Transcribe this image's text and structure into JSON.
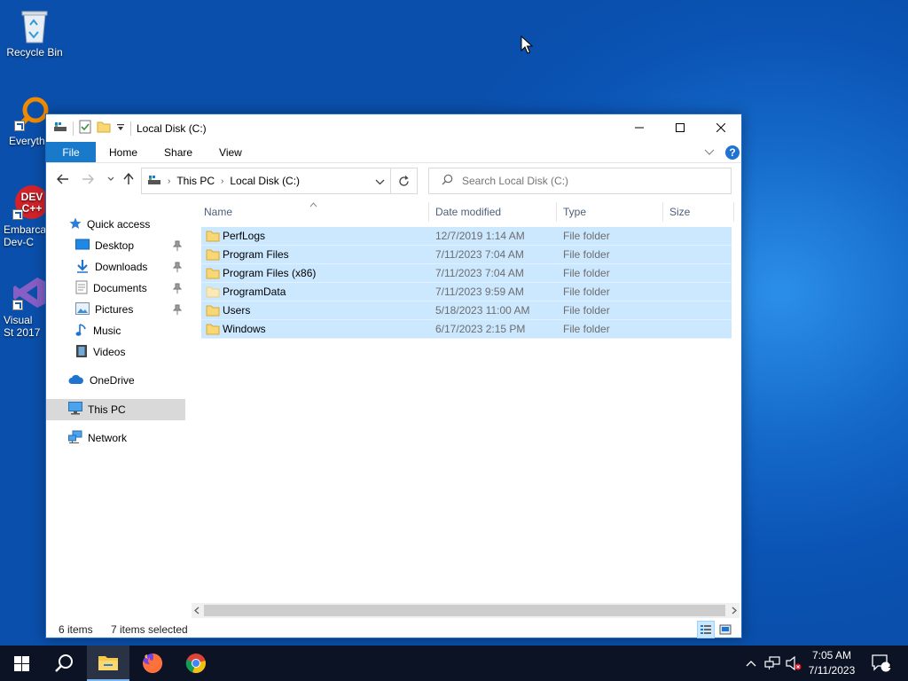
{
  "desktop": {
    "icons": [
      {
        "label": "Recycle Bin"
      },
      {
        "label": "Everyth"
      },
      {
        "label": "Embarca Dev-C"
      },
      {
        "label": "Visual St 2017"
      }
    ]
  },
  "window": {
    "title": "Local Disk (C:)",
    "ribbon_tabs": [
      "File",
      "Home",
      "Share",
      "View"
    ],
    "address": {
      "crumbs": [
        "This PC",
        "Local Disk (C:)"
      ]
    },
    "search_placeholder": "Search Local Disk (C:)",
    "sidebar": {
      "quick_access": "Quick access",
      "items": [
        "Desktop",
        "Downloads",
        "Documents",
        "Pictures",
        "Music",
        "Videos"
      ],
      "onedrive": "OneDrive",
      "this_pc": "This PC",
      "network": "Network"
    },
    "columns": [
      "Name",
      "Date modified",
      "Type",
      "Size"
    ],
    "files": [
      {
        "name": "PerfLogs",
        "date": "12/7/2019 1:14 AM",
        "type": "File folder"
      },
      {
        "name": "Program Files",
        "date": "7/11/2023 7:04 AM",
        "type": "File folder"
      },
      {
        "name": "Program Files (x86)",
        "date": "7/11/2023 7:04 AM",
        "type": "File folder"
      },
      {
        "name": "ProgramData",
        "date": "7/11/2023 9:59 AM",
        "type": "File folder"
      },
      {
        "name": "Users",
        "date": "5/18/2023 11:00 AM",
        "type": "File folder"
      },
      {
        "name": "Windows",
        "date": "6/17/2023 2:15 PM",
        "type": "File folder"
      }
    ],
    "status": {
      "item_count": "6 items",
      "selected": "7 items selected"
    }
  },
  "taskbar": {
    "clock_time": "7:05 AM",
    "clock_date": "7/11/2023",
    "notification_count": "1"
  },
  "colors": {
    "accent": "#1979ca",
    "selection": "#cce8ff",
    "folder": "#f8d775"
  }
}
